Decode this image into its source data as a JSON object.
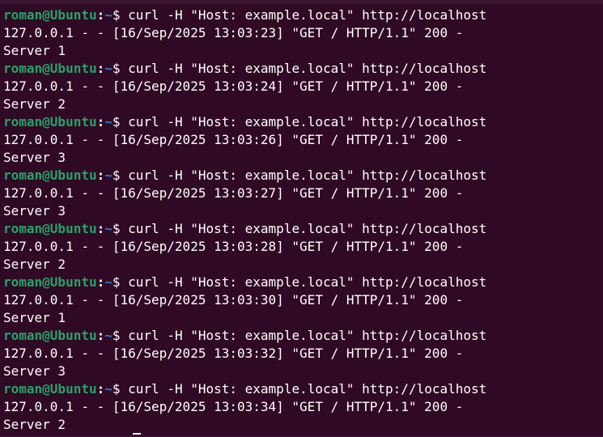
{
  "terminal": {
    "prompt": {
      "user_host": "roman@Ubuntu",
      "separator": ":",
      "cwd": "~",
      "symbol": "$"
    },
    "colors": {
      "background": "#300a24",
      "prompt_user": "#26a269",
      "prompt_path": "#2a7bde",
      "text": "#ffffff"
    },
    "entries": [
      {
        "command": "curl -H \"Host: example.local\" http://localhost",
        "log": "127.0.0.1 - - [16/Sep/2025 13:03:23] \"GET / HTTP/1.1\" 200 -",
        "response": "Server 1"
      },
      {
        "command": "curl -H \"Host: example.local\" http://localhost",
        "log": "127.0.0.1 - - [16/Sep/2025 13:03:24] \"GET / HTTP/1.1\" 200 -",
        "response": "Server 2"
      },
      {
        "command": "curl -H \"Host: example.local\" http://localhost",
        "log": "127.0.0.1 - - [16/Sep/2025 13:03:26] \"GET / HTTP/1.1\" 200 -",
        "response": "Server 3"
      },
      {
        "command": "curl -H \"Host: example.local\" http://localhost",
        "log": "127.0.0.1 - - [16/Sep/2025 13:03:27] \"GET / HTTP/1.1\" 200 -",
        "response": "Server 3"
      },
      {
        "command": "curl -H \"Host: example.local\" http://localhost",
        "log": "127.0.0.1 - - [16/Sep/2025 13:03:28] \"GET / HTTP/1.1\" 200 -",
        "response": "Server 2"
      },
      {
        "command": "curl -H \"Host: example.local\" http://localhost",
        "log": "127.0.0.1 - - [16/Sep/2025 13:03:30] \"GET / HTTP/1.1\" 200 -",
        "response": "Server 1"
      },
      {
        "command": "curl -H \"Host: example.local\" http://localhost",
        "log": "127.0.0.1 - - [16/Sep/2025 13:03:32] \"GET / HTTP/1.1\" 200 -",
        "response": "Server 3"
      },
      {
        "command": "curl -H \"Host: example.local\" http://localhost",
        "log": "127.0.0.1 - - [16/Sep/2025 13:03:34] \"GET / HTTP/1.1\" 200 -",
        "response": "Server 2"
      }
    ]
  }
}
